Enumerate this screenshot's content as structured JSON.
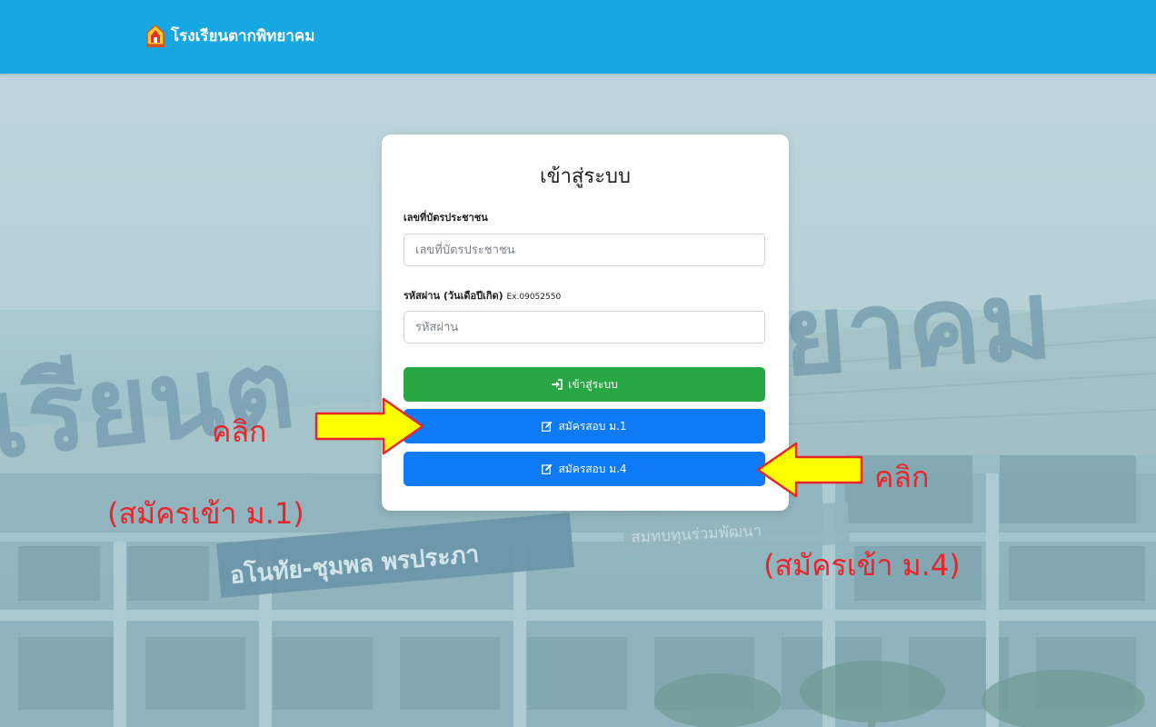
{
  "navbar": {
    "brand_name": "โรงเรียนตากพิทยาคม",
    "brand_icon": "school-emblem-icon",
    "color": "#17a8e3"
  },
  "background": {
    "sign_text_left": "เรียนต",
    "sign_text_right": "ยาคม",
    "plaque_text": "อโนทัย-ชุมพล พรประภา",
    "banner_text": "สมทบทุนร่วมพัฒนา"
  },
  "login": {
    "title": "เข้าสู่ระบบ",
    "id_label": "เลขที่บัตรประชาชน",
    "id_placeholder": "เลขที่บัตรประชาชน",
    "id_value": "",
    "password_label": "รหัสผ่าน (วันเดือปีเกิด)",
    "password_hint": "Ex.09052550",
    "password_placeholder": "รหัสผ่าน",
    "password_value": "",
    "login_button": "เข้าสู่ระบบ",
    "login_icon": "sign-in-icon",
    "register_m1_button": "สมัครสอบ ม.1",
    "register_m4_button": "สมัครสอบ ม.4",
    "register_icon": "edit-icon",
    "colors": {
      "login_button": "#28a745",
      "register_button": "#0d7bf5"
    }
  },
  "annotations": {
    "left_click": "คลิก",
    "left_caption": "(สมัครเข้า ม.1)",
    "right_click": "คลิก",
    "right_caption": "(สมัครเข้า ม.4)",
    "text_color": "#e8252a",
    "arrow_fill": "#ffff00",
    "arrow_stroke": "#e8252a"
  }
}
